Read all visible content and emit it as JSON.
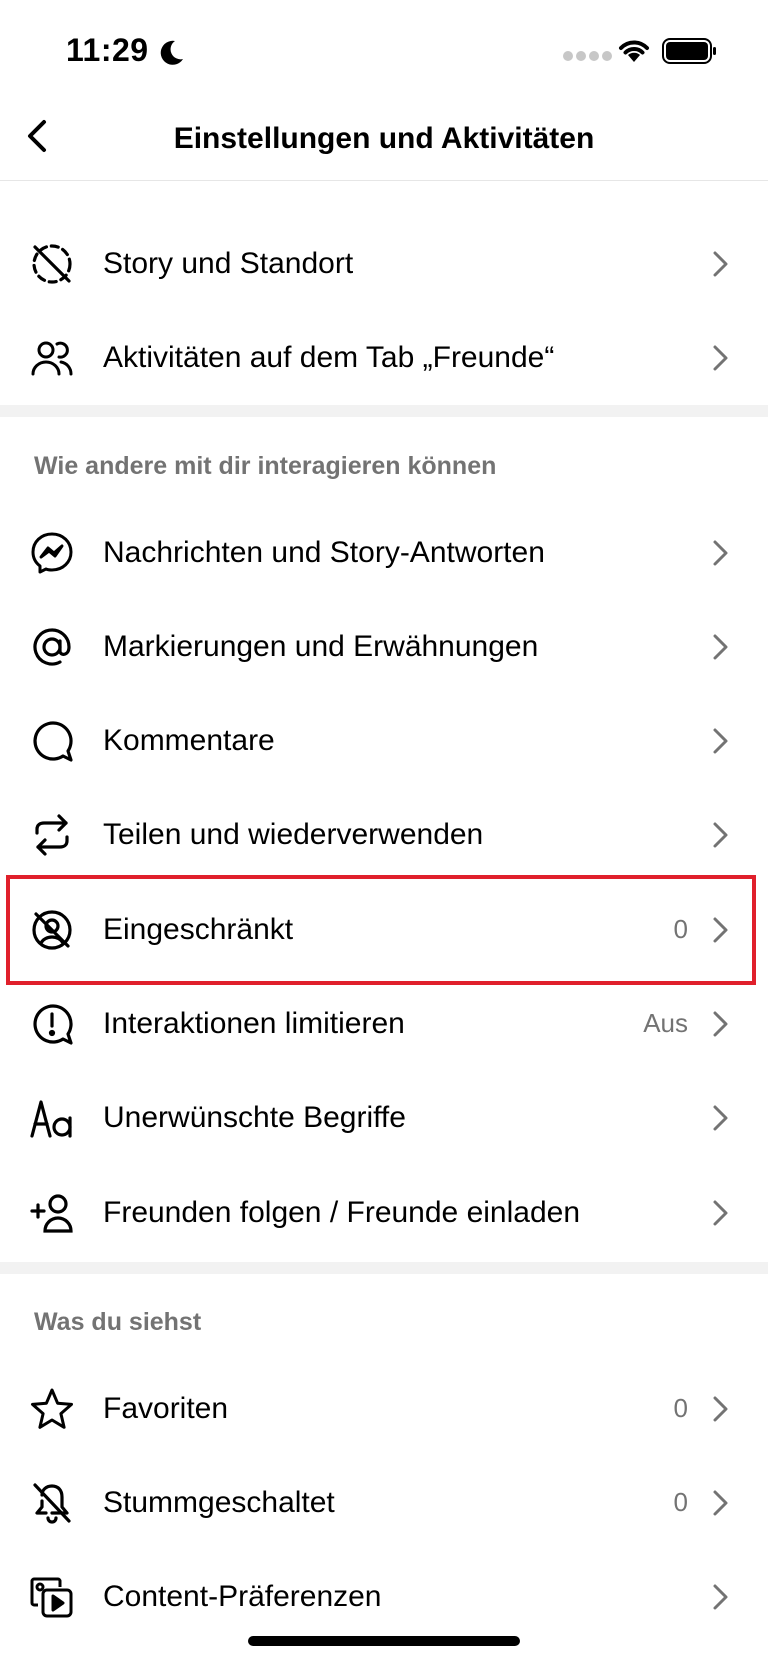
{
  "status_bar": {
    "time": "11:29"
  },
  "nav": {
    "title": "Einstellungen und Aktivitäten"
  },
  "section1": {
    "items": [
      {
        "label": "Story und Standort",
        "value": ""
      },
      {
        "label": "Aktivitäten auf dem Tab „Freunde“",
        "value": ""
      }
    ]
  },
  "section2": {
    "header": "Wie andere mit dir interagieren können",
    "items": [
      {
        "label": "Nachrichten und Story-Antworten",
        "value": ""
      },
      {
        "label": "Markierungen und Erwähnungen",
        "value": ""
      },
      {
        "label": "Kommentare",
        "value": ""
      },
      {
        "label": "Teilen und wiederverwenden",
        "value": ""
      },
      {
        "label": "Eingeschränkt",
        "value": "0"
      },
      {
        "label": "Interaktionen limitieren",
        "value": "Aus"
      },
      {
        "label": "Unerwünschte Begriffe",
        "value": ""
      },
      {
        "label": "Freunden folgen / Freunde einladen",
        "value": ""
      }
    ]
  },
  "section3": {
    "header": "Was du siehst",
    "items": [
      {
        "label": "Favoriten",
        "value": "0"
      },
      {
        "label": "Stummgeschaltet",
        "value": "0"
      },
      {
        "label": "Content-Präferenzen",
        "value": ""
      }
    ]
  },
  "icons": {
    "hidden_story": "story-hidden-icon",
    "friends": "people-icon",
    "messages": "messenger-icon",
    "mentions": "at-sign-icon",
    "comments": "comment-bubble-icon",
    "share": "repeat-icon",
    "restricted": "restricted-icon",
    "limit": "exclamation-bubble-icon",
    "words": "text-aa-icon",
    "invite": "add-person-icon",
    "favorites": "star-icon",
    "muted": "bell-off-icon",
    "content": "media-play-icon",
    "chevron": "chevron-right-icon"
  },
  "colors": {
    "highlight": "#e0202b",
    "secondary_text": "#737373",
    "divider": "#f2f2f2"
  }
}
